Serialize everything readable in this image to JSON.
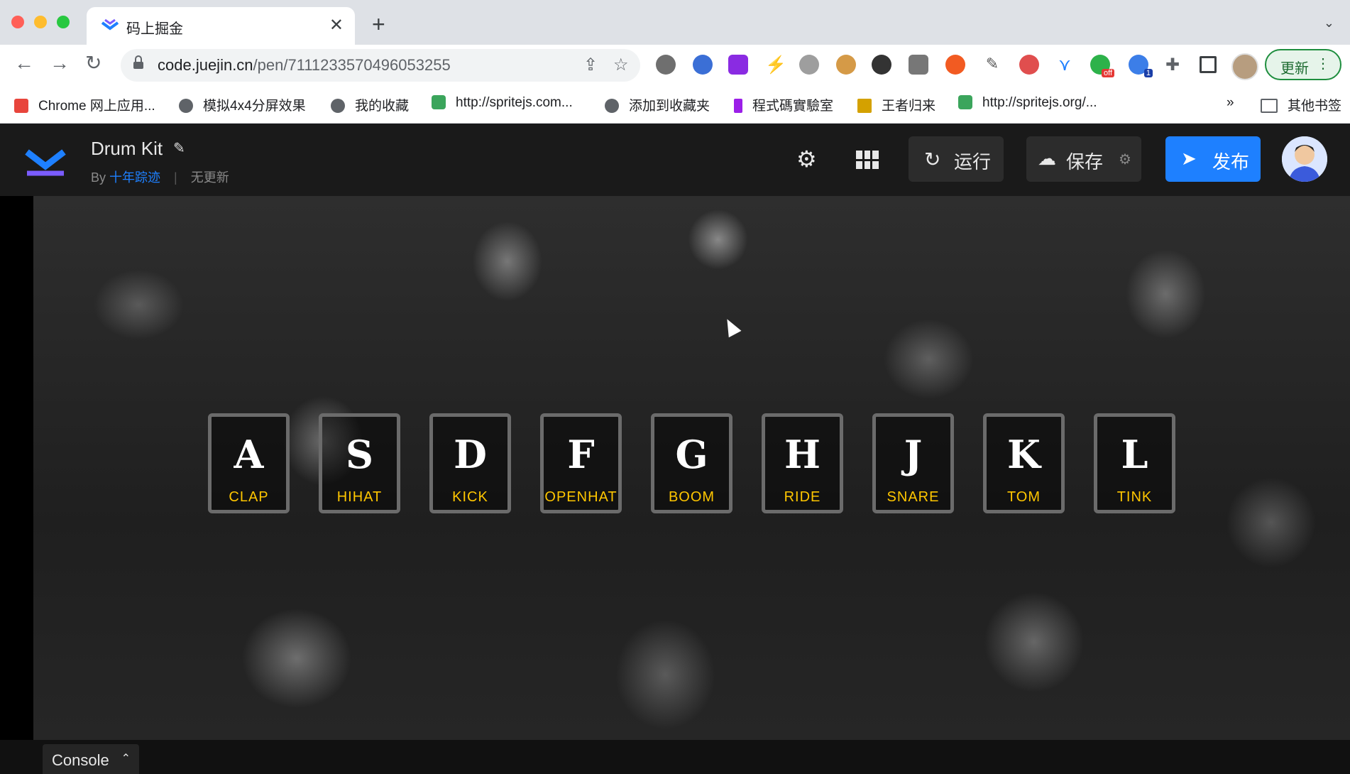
{
  "browser": {
    "tab_title": "码上掘金",
    "url_domain": "code.juejin.cn",
    "url_path": "/pen/7111233570496053255",
    "update_label": "更新",
    "bookmarks": [
      {
        "label": "Chrome 网上应用...",
        "icon": "chrome-store-icon",
        "color": "#e8453c"
      },
      {
        "label": "模拟4x4分屏效果",
        "icon": "globe-icon",
        "color": "#5f6368"
      },
      {
        "label": "我的收藏",
        "icon": "globe-icon",
        "color": "#5f6368"
      },
      {
        "label": "http://spritejs.com...",
        "icon": "spritejs-icon",
        "color": "#3ba55c"
      },
      {
        "label": "添加到收藏夹",
        "icon": "globe-icon",
        "color": "#5f6368"
      },
      {
        "label": "程式碼實驗室",
        "icon": "codelab-icon",
        "color": "#9b1fe8"
      },
      {
        "label": "王者归来",
        "icon": "crown-icon",
        "color": "#d4a100"
      },
      {
        "label": "http://spritejs.org/...",
        "icon": "spritejs-icon",
        "color": "#3ba55c"
      }
    ],
    "more_bookmarks": "»",
    "other_bookmarks": "其他书签",
    "extension_badges": {
      "off": "off",
      "count": "1"
    }
  },
  "header": {
    "title": "Drum Kit",
    "by": "By",
    "author": "十年踪迹",
    "status": "无更新",
    "run_label": "运行",
    "save_label": "保存",
    "publish_label": "发布"
  },
  "drum_kit": {
    "keys": [
      {
        "letter": "A",
        "sound": "CLAP"
      },
      {
        "letter": "S",
        "sound": "HIHAT"
      },
      {
        "letter": "D",
        "sound": "KICK"
      },
      {
        "letter": "F",
        "sound": "OPENHAT"
      },
      {
        "letter": "G",
        "sound": "BOOM"
      },
      {
        "letter": "H",
        "sound": "RIDE"
      },
      {
        "letter": "J",
        "sound": "SNARE"
      },
      {
        "letter": "K",
        "sound": "TOM"
      },
      {
        "letter": "L",
        "sound": "TINK"
      }
    ]
  },
  "console": {
    "label": "Console"
  },
  "colors": {
    "accent": "#1e80ff",
    "sound_label": "#ffc600",
    "header_bg": "#1a1a1a"
  }
}
